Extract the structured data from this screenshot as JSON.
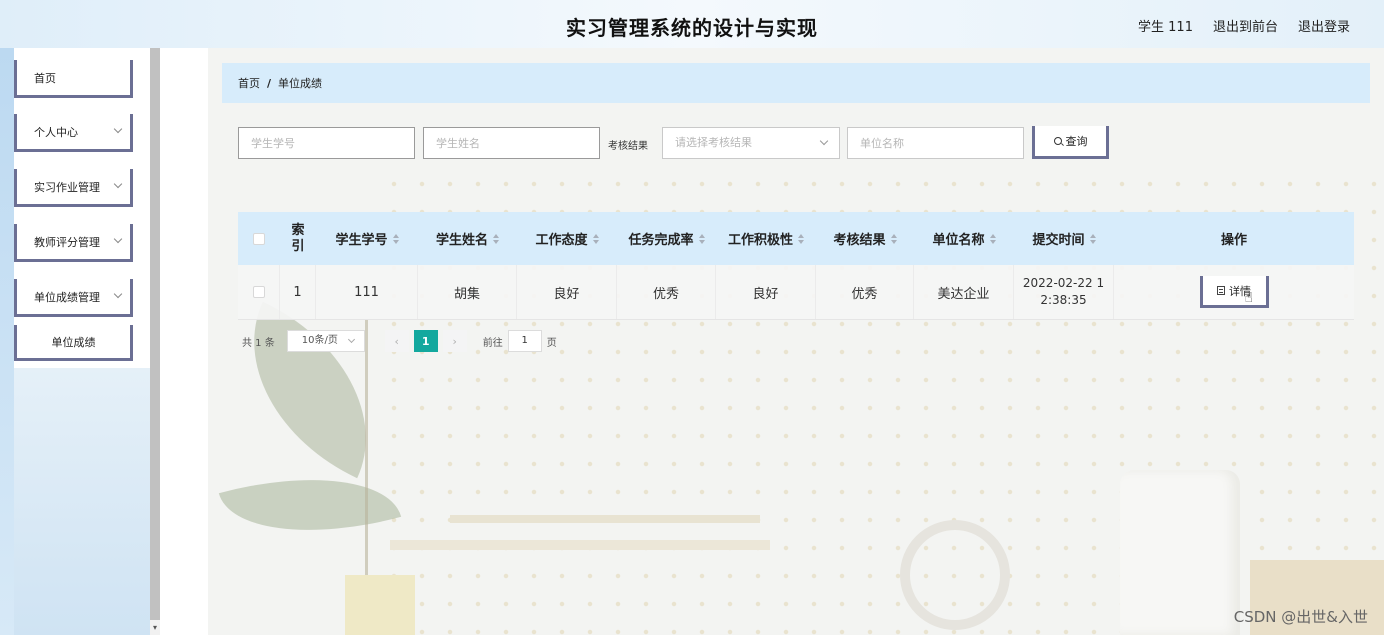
{
  "header": {
    "title": "实习管理系统的设计与实现",
    "user_label": "学生 111",
    "back_frontend": "退出到前台",
    "logout": "退出登录"
  },
  "sidebar": {
    "items": [
      {
        "label": "首页",
        "has_submenu": false
      },
      {
        "label": "个人中心",
        "has_submenu": true
      },
      {
        "label": "实习作业管理",
        "has_submenu": true
      },
      {
        "label": "教师评分管理",
        "has_submenu": true
      },
      {
        "label": "单位成绩管理",
        "has_submenu": true
      }
    ],
    "subitem": "单位成绩"
  },
  "breadcrumb": {
    "home": "首页",
    "separator": "/",
    "current": "单位成绩"
  },
  "search": {
    "student_id_placeholder": "学生学号",
    "student_name_placeholder": "学生姓名",
    "result_label": "考核结果",
    "result_placeholder": "请选择考核结果",
    "company_placeholder": "单位名称",
    "query_button": "查询"
  },
  "table": {
    "columns": [
      "索引",
      "学生学号",
      "学生姓名",
      "工作态度",
      "任务完成率",
      "工作积极性",
      "考核结果",
      "单位名称",
      "提交时间",
      "操作"
    ],
    "rows": [
      {
        "index": "1",
        "student_id": "111",
        "student_name": "胡集",
        "attitude": "良好",
        "completion": "优秀",
        "initiative": "良好",
        "result": "优秀",
        "company": "美达企业",
        "submit_time": "2022-02-22 12:38:35",
        "action": "详情"
      }
    ]
  },
  "pagination": {
    "total": "共 1 条",
    "page_size": "10条/页",
    "current_page": "1",
    "goto_label": "前往",
    "goto_value": "1",
    "page_suffix": "页"
  },
  "watermark": "CSDN @出世&入世",
  "colors": {
    "accent_border": "#6b6f94",
    "header_bg": "#d7ecfb",
    "page_active": "#13a89e"
  }
}
